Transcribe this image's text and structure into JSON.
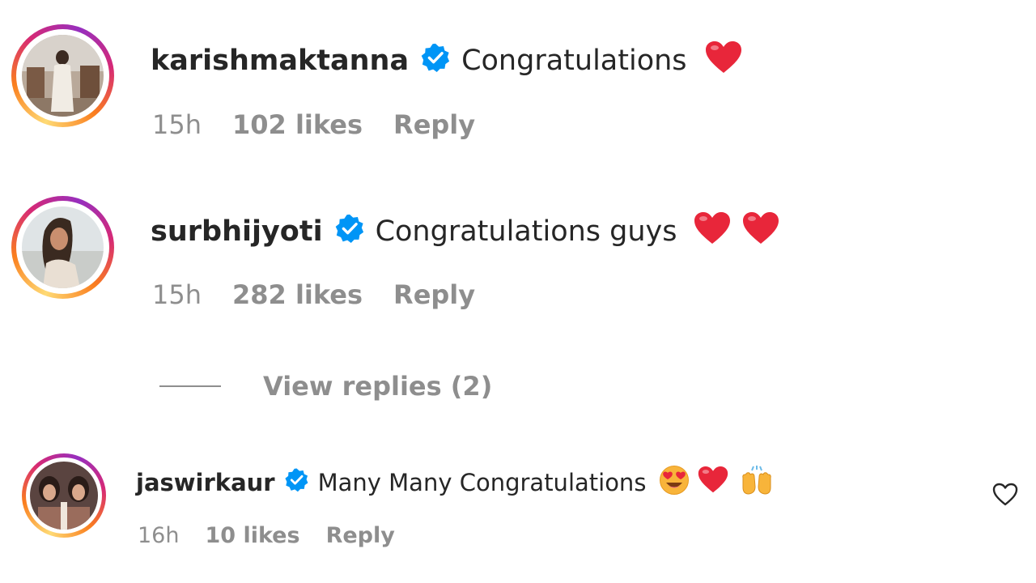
{
  "comments": [
    {
      "username": "karishmaktanna",
      "verified": true,
      "text": "Congratulations",
      "emojis": [
        "red-heart"
      ],
      "time": "15h",
      "likes": "102 likes",
      "reply": "Reply"
    },
    {
      "username": "surbhijyoti",
      "verified": true,
      "text": "Congratulations guys",
      "emojis": [
        "red-heart",
        "red-heart"
      ],
      "time": "15h",
      "likes": "282 likes",
      "reply": "Reply",
      "view_replies": "View replies (2)"
    },
    {
      "username": "jaswirkaur",
      "verified": true,
      "text": "Many Many Congratulations",
      "emojis": [
        "heart-eyes-smiley",
        "red-heart",
        "raising-hands"
      ],
      "time": "16h",
      "likes": "10 likes",
      "reply": "Reply"
    }
  ],
  "colors": {
    "verified_blue": "#0095f6",
    "heart_red": "#e8263a",
    "meta_gray": "#8e8e8e",
    "text_dark": "#262626"
  },
  "icons": {
    "like": "heart-outline-icon",
    "verified": "verified-badge-icon"
  }
}
